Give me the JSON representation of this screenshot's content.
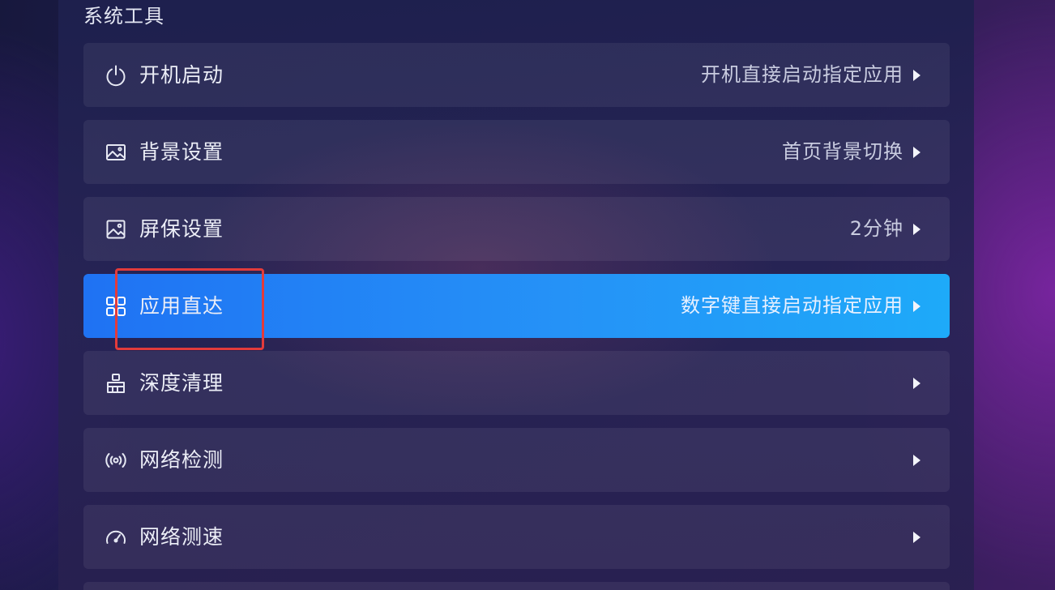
{
  "section": {
    "title": "系统工具"
  },
  "items": [
    {
      "label": "开机启动",
      "value": "开机直接启动指定应用",
      "icon": "power-icon"
    },
    {
      "label": "背景设置",
      "value": "首页背景切换",
      "icon": "image-icon"
    },
    {
      "label": "屏保设置",
      "value": "2分钟",
      "icon": "screensaver-icon"
    },
    {
      "label": "应用直达",
      "value": "数字键直接启动指定应用",
      "icon": "apps-grid-icon"
    },
    {
      "label": "深度清理",
      "value": "",
      "icon": "broom-icon"
    },
    {
      "label": "网络检测",
      "value": "",
      "icon": "signal-icon"
    },
    {
      "label": "网络测速",
      "value": "",
      "icon": "speedometer-icon"
    }
  ],
  "selected_index": 3,
  "colors": {
    "accent_start": "#1f72f3",
    "accent_end": "#1eaaf9",
    "highlight_box": "#e33b3b"
  }
}
